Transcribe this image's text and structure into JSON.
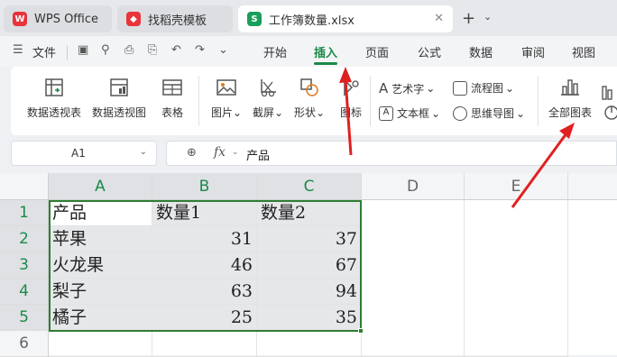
{
  "tabs": [
    {
      "label": "WPS Office"
    },
    {
      "label": "找稻壳模板"
    },
    {
      "label": "工作簿数量.xlsx"
    }
  ],
  "menu": {
    "file": "文件",
    "items": [
      "开始",
      "插入",
      "页面",
      "公式",
      "数据",
      "审阅",
      "视图"
    ],
    "active": "插入"
  },
  "ribbon": {
    "pivot_table": "数据透视表",
    "pivot_chart": "数据透视图",
    "table": "表格",
    "picture": "图片",
    "screenshot": "截屏",
    "shape": "形状",
    "icon": "图标",
    "wordart": "艺术字",
    "textbox": "文本框",
    "flowchart": "流程图",
    "mindmap": "思维导图",
    "all_charts": "全部图表"
  },
  "formula_bar": {
    "cell_ref": "A1",
    "fx": "fx",
    "value": "产品"
  },
  "sheet": {
    "columns": [
      "A",
      "B",
      "C",
      "D",
      "E"
    ],
    "rows": [
      "1",
      "2",
      "3",
      "4",
      "5",
      "6"
    ],
    "cells": [
      [
        "产品",
        "数量1",
        "数量2"
      ],
      [
        "苹果",
        "31",
        "37"
      ],
      [
        "火龙果",
        "46",
        "67"
      ],
      [
        "梨子",
        "63",
        "94"
      ],
      [
        "橘子",
        "25",
        "35"
      ]
    ]
  },
  "colors": {
    "accent": "#1a8a4a",
    "selection_border": "#2e7d32",
    "arrow": "#e02020",
    "wps_logo": "#e8343a",
    "sheet_logo": "#1a9e5c"
  }
}
